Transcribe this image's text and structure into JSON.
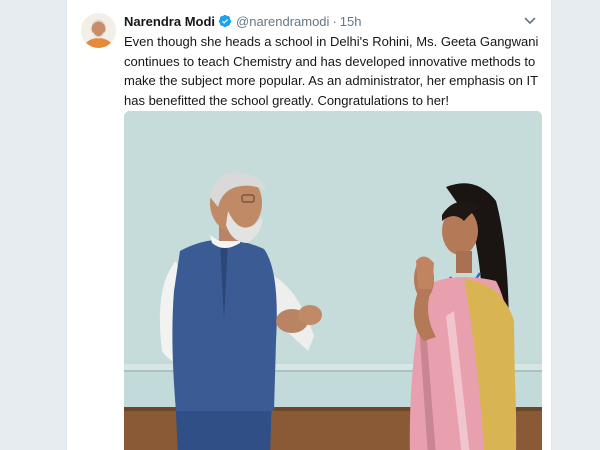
{
  "tweet": {
    "author_name": "Narendra Modi",
    "author_handle": "@narendramodi",
    "separator": "·",
    "time": "15h",
    "text": "Even though she heads a school in Delhi's Rohini, Ms. Geeta Gangwani continues to teach Chemistry and has developed innovative methods to make the subject more popular. As an administrator, her emphasis on IT has benefitted the school greatly. Congratulations to her!",
    "verified": true,
    "menu_icon": "chevron-down-icon"
  },
  "colors": {
    "page_background": "#e6ecf0",
    "card_background": "#ffffff",
    "name_text": "#14171a",
    "secondary_text": "#657786",
    "verified_badge": "#1da1f2",
    "photo_wall": "#bfd7d6",
    "vest": "#3b5b95",
    "saree_pink": "#e8a0ae",
    "saree_gold": "#d8b552"
  }
}
